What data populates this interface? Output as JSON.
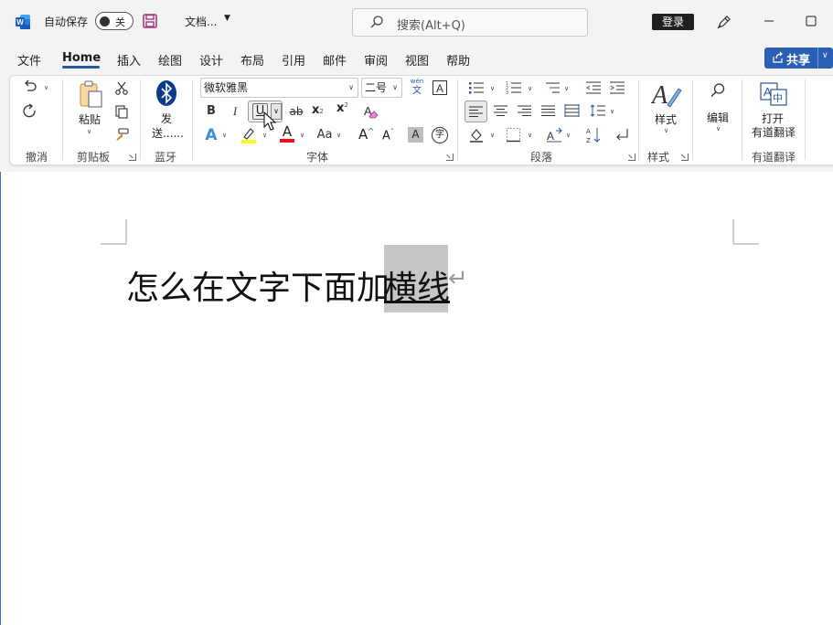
{
  "titlebar": {
    "autosave_label": "自动保存",
    "autosave_state": "关",
    "doc_title": "文档...",
    "search_placeholder": "搜索(Alt+Q)",
    "login_label": "登录"
  },
  "menu": {
    "tabs": [
      "文件",
      "Home",
      "插入",
      "绘图",
      "设计",
      "布局",
      "引用",
      "邮件",
      "审阅",
      "视图",
      "帮助"
    ],
    "active_tab": "Home",
    "share_label": "共享"
  },
  "ribbon": {
    "groups": {
      "undo": "撤消",
      "clipboard": "剪贴板",
      "bluetooth": "蓝牙",
      "font": "字体",
      "paragraph": "段落",
      "styles": "样式",
      "youdao": "有道翻译"
    },
    "paste_label": "粘贴",
    "send_label_1": "发",
    "send_label_2": "送......",
    "font_name": "微软雅黑",
    "font_size": "二号",
    "wen_top": "wén",
    "wen_bottom": "文",
    "styles_label": "样式",
    "edit_label": "编辑",
    "open_label": "打开",
    "youdao_label": "有道翻译",
    "format_buttons": {
      "bold": "B",
      "italic": "I",
      "underline": "U",
      "strike": "ab",
      "subscript": "x",
      "superscript": "x",
      "text_effects": "A",
      "font_color": "A",
      "change_case": "Aa",
      "grow": "A",
      "shrink": "A",
      "char_shading": "A",
      "enclose": "字"
    }
  },
  "document": {
    "text_before": "怎么在文字下面加",
    "text_selected": "横线",
    "para_mark": "↵"
  },
  "colors": {
    "accent": "#2b579a",
    "share_bg": "#2b5fb3",
    "highlight_yellow": "#ffff00",
    "font_red": "#e81123",
    "selection": "#c6c6c6"
  }
}
